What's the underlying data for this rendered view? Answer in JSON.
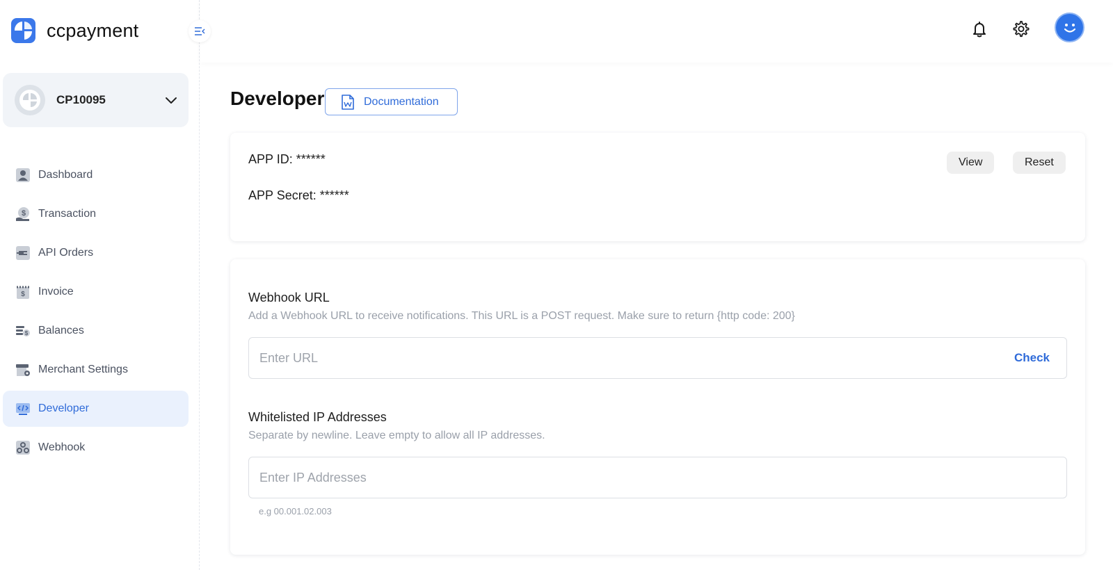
{
  "brand": {
    "name": "ccpayment"
  },
  "merchant": {
    "id": "CP10095"
  },
  "nav": {
    "items": [
      {
        "label": "Dashboard",
        "icon": "dashboard-icon",
        "active": false
      },
      {
        "label": "Transaction",
        "icon": "transaction-icon",
        "active": false
      },
      {
        "label": "API Orders",
        "icon": "api-orders-icon",
        "active": false
      },
      {
        "label": "Invoice",
        "icon": "invoice-icon",
        "active": false
      },
      {
        "label": "Balances",
        "icon": "balances-icon",
        "active": false
      },
      {
        "label": "Merchant Settings",
        "icon": "merchant-settings-icon",
        "active": false
      },
      {
        "label": "Developer",
        "icon": "developer-icon",
        "active": true
      },
      {
        "label": "Webhook",
        "icon": "webhook-icon",
        "active": false
      }
    ]
  },
  "page": {
    "title": "Developer",
    "doc_button": "Documentation"
  },
  "credentials": {
    "app_id": "APP ID: ******",
    "app_secret": "APP Secret: ******",
    "view_label": "View",
    "reset_label": "Reset"
  },
  "webhook": {
    "title": "Webhook URL",
    "description": "Add a Webhook URL to receive notifications. This URL is a POST request. Make sure to return {http code: 200}",
    "url_placeholder": "Enter URL",
    "url_value": "",
    "check_label": "Check"
  },
  "whitelist": {
    "title": "Whitelisted IP Addresses",
    "description": "Separate by newline. Leave empty to allow all IP addresses.",
    "ip_placeholder": "Enter IP Addresses",
    "ip_value": "",
    "hint": "e.g 00.001.02.003"
  },
  "colors": {
    "accent": "#2f6bd9",
    "active_nav_bg": "#eaf1fd",
    "avatar": "#2f74e8"
  }
}
